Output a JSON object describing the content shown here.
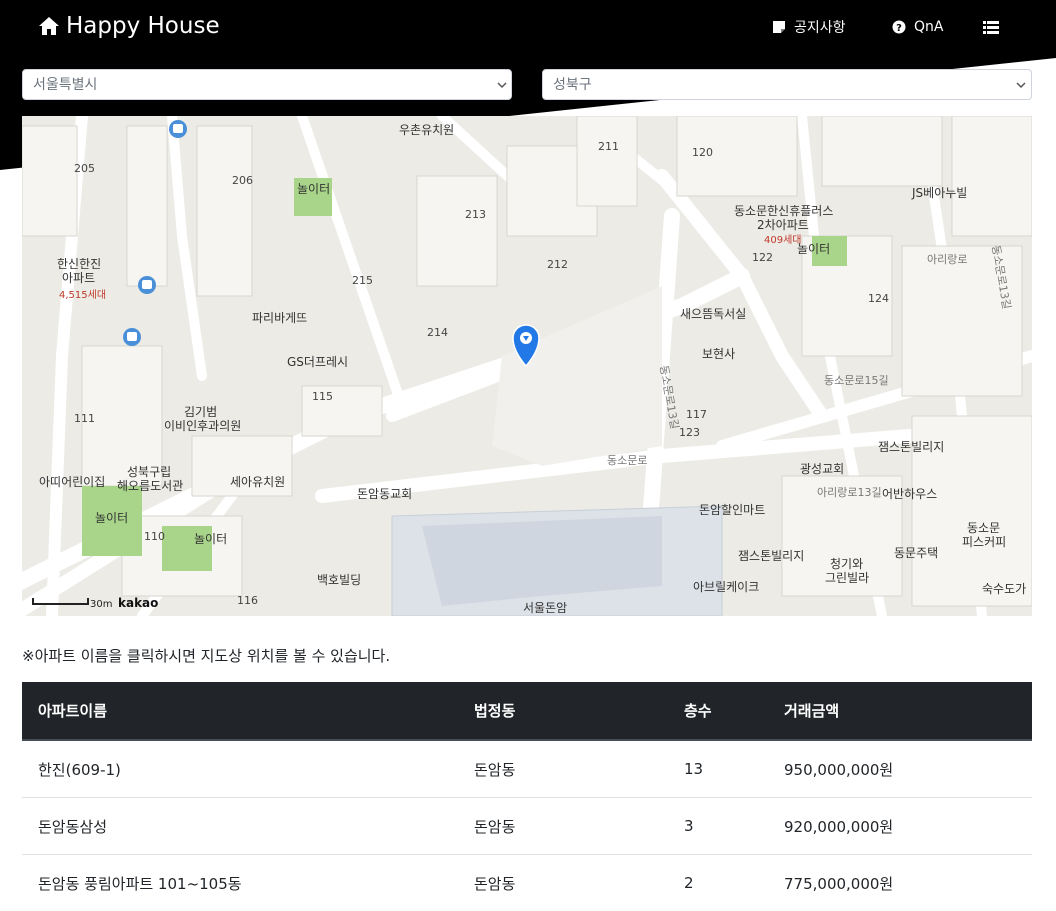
{
  "header": {
    "brand": "Happy House",
    "brand_icon": "home-icon",
    "nav": [
      {
        "label": "공지사항",
        "icon": "notice-icon"
      },
      {
        "label": "QnA",
        "icon": "question-circle-icon"
      }
    ],
    "menu_icon": "list-icon"
  },
  "filters": {
    "city": "서울특별시",
    "district": "성북구"
  },
  "map": {
    "provider": "kakao",
    "scale_label": "30m",
    "labels": {
      "school1": "우촌유치원",
      "park1": "놀이터",
      "apt_hanjin": "한신한진",
      "apt_hanjin2": "아파트",
      "apt_hanjin_units": "4,515세대",
      "bakery": "파리바게뜨",
      "gs": "GS더프레시",
      "clinic1": "김기범",
      "clinic2": "이비인후과의원",
      "lib1": "성북구립",
      "lib2": "해오름도서관",
      "kinder1": "아띠어린이집",
      "kinder2": "세아유치원",
      "park2": "놀이터",
      "park3": "놀이터",
      "church1": "돈암동교회",
      "bld_baekho": "백호빌딩",
      "school2": "서울돈암",
      "road1": "동소문로13길",
      "road2": "동소문로",
      "road3": "동소문로15길",
      "apt_sinhue": "동소문한신휴플러스",
      "apt_sinhue2": "2차아파트",
      "apt_sinhue_units": "409세대",
      "park4": "놀이터",
      "js": "JS베아누빌",
      "bookstore": "새으뜸독서실",
      "temple": "보현사",
      "church2": "광성교회",
      "villa1": "잼스톤빌리지",
      "villa2": "잼스톤빌리지",
      "house": "어반하우스",
      "mart": "돈암할인마트",
      "pizza1": "동소문",
      "pizza2": "피스커피",
      "dongmun": "동문주택",
      "villa3": "청기와",
      "villa4": "그린빌라",
      "cake": "아브릴케이크",
      "sushi": "숙수도가",
      "arirang1": "아리랑로",
      "arirang2": "아리랑로13길",
      "road4": "동소문로13길",
      "lot212": "212",
      "lot213": "213",
      "lot214": "214",
      "lot215": "215",
      "lot115": "115",
      "lot117": "117",
      "lot111": "111",
      "lot110": "110",
      "lot116": "116",
      "lot205": "205",
      "lot206": "206",
      "lot211": "211",
      "lot120": "120",
      "lot122": "122",
      "lot124": "124",
      "lot123": "123"
    }
  },
  "notice": "※아파트 이름을 클릭하시면 지도상 위치를 볼 수 있습니다.",
  "table": {
    "headers": [
      "아파트이름",
      "법정동",
      "층수",
      "거래금액"
    ],
    "rows": [
      [
        "한진(609-1)",
        "돈암동",
        "13",
        "950,000,000원"
      ],
      [
        "돈암동삼성",
        "돈암동",
        "3",
        "920,000,000원"
      ],
      [
        "돈암동 풍림아파트 101~105동",
        "돈암동",
        "2",
        "775,000,000원"
      ]
    ]
  }
}
